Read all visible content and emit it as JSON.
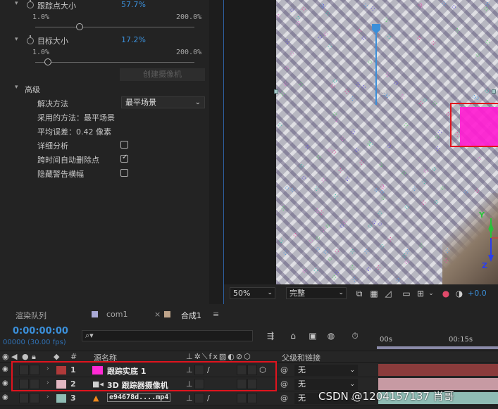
{
  "effect_controls": {
    "track_point_size": {
      "label": "跟踪点大小",
      "value": "57.7%",
      "min": "1.0%",
      "max": "200.0%",
      "level_pct": 28
    },
    "target_size": {
      "label": "目标大小",
      "value": "17.2%",
      "min": "1.0%",
      "max": "200.0%",
      "level_pct": 8
    },
    "create_camera_button": "创建摄像机",
    "advanced": {
      "label": "高级",
      "solve_method_label": "解决方法",
      "solve_method_value": "最平场景",
      "method_used": "采用的方法：最平场景",
      "avg_error": "平均误差：0.42 像素",
      "detailed_analysis": {
        "label": "详细分析",
        "checked": false
      },
      "auto_delete_points": {
        "label": "跨时间自动删除点",
        "checked": true
      },
      "hide_warning_banner": {
        "label": "隐藏警告横幅",
        "checked": false
      }
    }
  },
  "viewer": {
    "axis_labels": {
      "y": "Y",
      "z": "Z"
    },
    "zoom": "50%",
    "resolution": "完整",
    "exposure": "+0.0"
  },
  "timeline": {
    "tabs": [
      "渲染队列",
      "com1",
      "合成1"
    ],
    "tab_close": "×",
    "tab_menu": "≡",
    "timecode": "0:00:00:00",
    "fps": "00000 (30.00 fps)",
    "search_icon": "search-icon",
    "ruler": [
      "00s",
      "00:15s"
    ],
    "columns": {
      "number": "#",
      "source_name": "源名称",
      "parent": "父级和链接"
    },
    "layers": [
      {
        "number": "1",
        "name": "跟踪实底 1",
        "label_color": "#b03a3a",
        "swatch_color": "#ff2ad5",
        "parent": "无",
        "bar_color": "#8a3b3b",
        "icon": "solid-icon"
      },
      {
        "number": "2",
        "name": "3D 跟踪器摄像机",
        "label_color": "#e3b8c3",
        "swatch_color": "",
        "parent": "无",
        "bar_color": "#c79aa3",
        "icon": "camera-icon"
      },
      {
        "number": "3",
        "name": "e94678d....mp4",
        "label_color": "#8fbcb4",
        "swatch_color": "",
        "parent": "无",
        "bar_color": "#8fbcb4",
        "icon": "vlc-icon"
      }
    ]
  },
  "watermark": "CSDN @1204157137 肖哥",
  "colors": {
    "accent": "#3b8fd9",
    "highlight_box": "#e0141e",
    "solid": "#ff1ed2"
  }
}
